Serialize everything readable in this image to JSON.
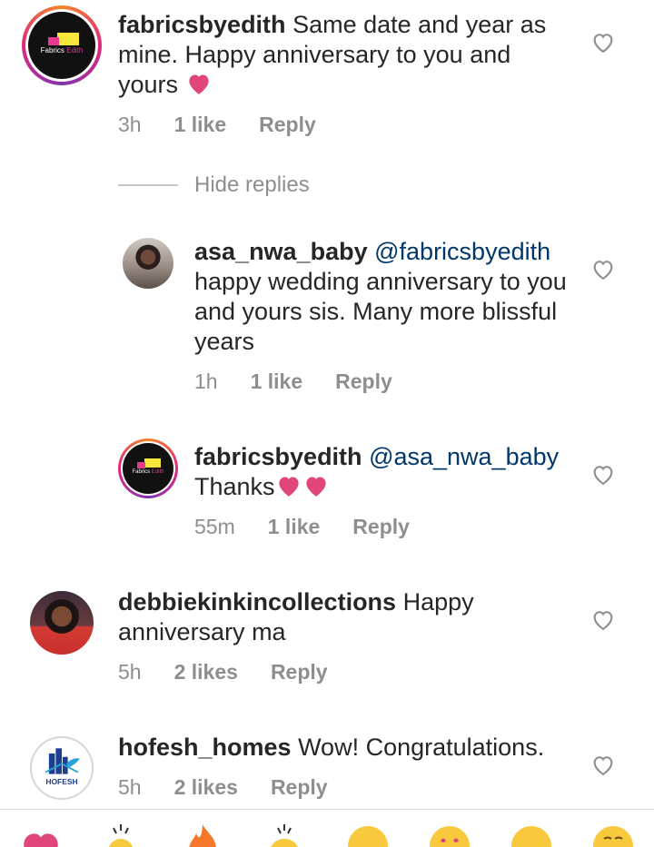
{
  "comments": [
    {
      "username": "fabricsbyedith",
      "text": "Same date and year as mine. Happy anniversary to you and yours",
      "time": "3h",
      "likes": "1 like",
      "reply": "Reply",
      "avatar_logo": "Fabrics by Edith"
    },
    {
      "username": "debbiekinkincollections",
      "text": "Happy anniversary ma",
      "time": "5h",
      "likes": "2 likes",
      "reply": "Reply"
    },
    {
      "username": "hofesh_homes",
      "text": "Wow! Congratulations.",
      "time": "5h",
      "likes": "2 likes",
      "reply": "Reply",
      "avatar_logo": "HOFESH"
    }
  ],
  "hide_replies": "Hide replies",
  "replies": [
    {
      "username": "asa_nwa_baby",
      "mention": "@fabricsbyedith",
      "text": "happy wedding anniversary to you and yours sis. Many more blissful years",
      "time": "1h",
      "likes": "1 like",
      "reply": "Reply"
    },
    {
      "username": "fabricsbyedith",
      "mention": "@asa_nwa_baby",
      "text": "Thanks",
      "time": "55m",
      "likes": "1 like",
      "reply": "Reply",
      "avatar_logo": "Fabrics by Edith"
    }
  ],
  "emoji_bar": [
    "heart",
    "clapping-hands",
    "fire",
    "raising-hands",
    "smiling-face",
    "heart-eyes",
    "grinning-face",
    "laughing-face"
  ],
  "colors": {
    "heart": "#e0457b",
    "username": "#262626",
    "mention": "#00376b",
    "meta": "#8e8e8e"
  }
}
